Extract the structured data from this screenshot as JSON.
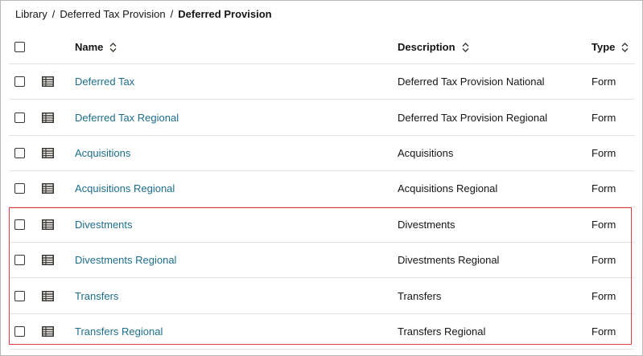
{
  "breadcrumb": {
    "items": [
      "Library",
      "Deferred Tax Provision"
    ],
    "separator": "/",
    "current": "Deferred Provision"
  },
  "table": {
    "columns": {
      "name": "Name",
      "description": "Description",
      "type": "Type"
    },
    "rows": [
      {
        "name": "Deferred Tax",
        "description": "Deferred Tax Provision National",
        "type": "Form",
        "icon": "table-icon"
      },
      {
        "name": "Deferred Tax Regional",
        "description": "Deferred Tax Provision Regional",
        "type": "Form",
        "icon": "table-icon"
      },
      {
        "name": "Acquisitions",
        "description": "Acquisitions",
        "type": "Form",
        "icon": "table-icon"
      },
      {
        "name": "Acquisitions Regional",
        "description": "Acquisitions Regional",
        "type": "Form",
        "icon": "table-icon"
      },
      {
        "name": "Divestments",
        "description": "Divestments",
        "type": "Form",
        "icon": "table-icon"
      },
      {
        "name": "Divestments Regional",
        "description": "Divestments Regional",
        "type": "Form",
        "icon": "table-icon"
      },
      {
        "name": "Transfers",
        "description": "Transfers",
        "type": "Form",
        "icon": "table-icon"
      },
      {
        "name": "Transfers Regional",
        "description": "Transfers Regional",
        "type": "Form",
        "icon": "table-icon"
      }
    ]
  },
  "colors": {
    "link": "#1c6e8c",
    "highlight_border": "#e03a3e",
    "row_divider": "#e4e1dd"
  }
}
